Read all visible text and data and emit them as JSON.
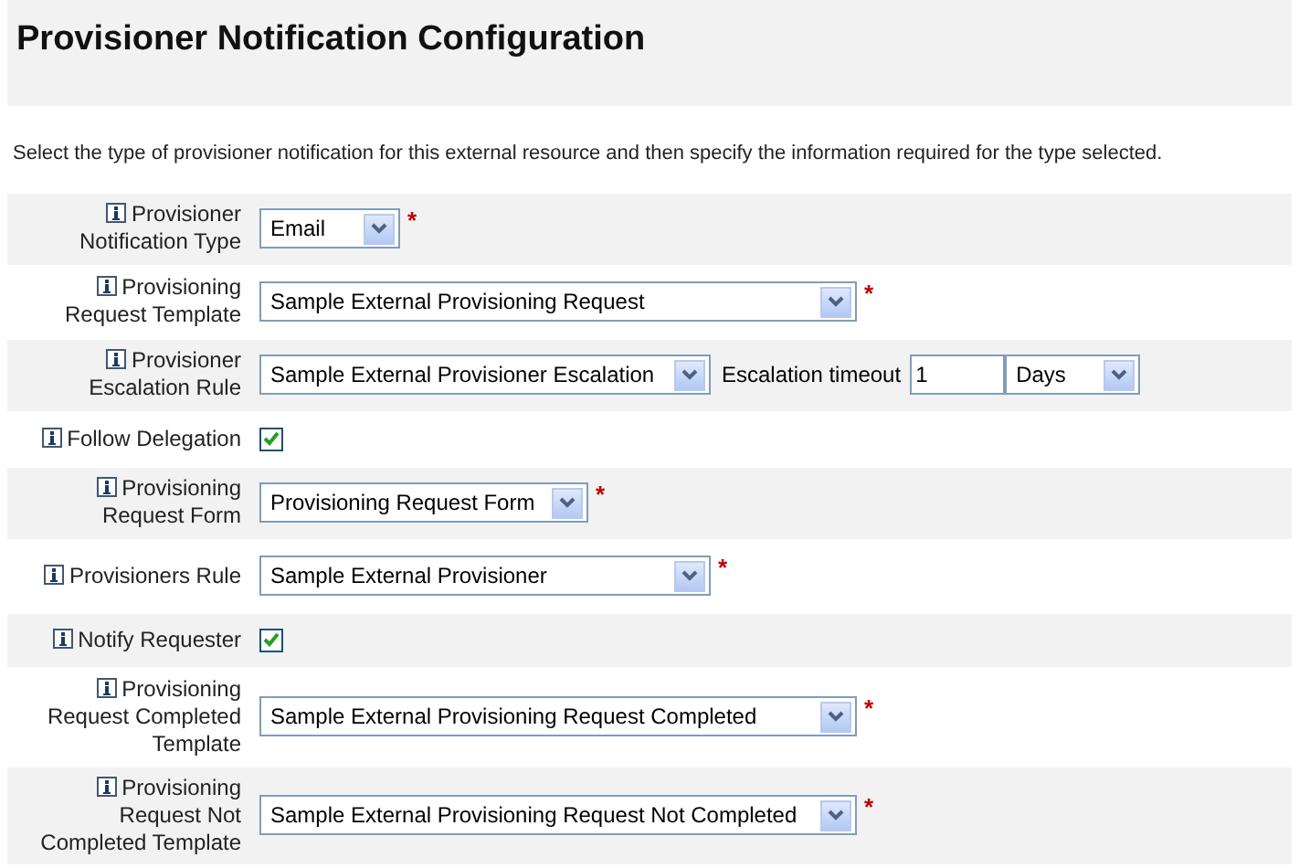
{
  "page": {
    "title": "Provisioner Notification Configuration",
    "description": "Select the type of provisioner notification for this external resource and then specify the information required for the type selected."
  },
  "rows": [
    {
      "kind": "select",
      "label": "Provisioner Notification Type",
      "value": "Email",
      "required_mark": "*"
    },
    {
      "kind": "select",
      "label": "Provisioning Request Template",
      "value": "Sample External Provisioning Request",
      "required_mark": "*"
    },
    {
      "kind": "select",
      "label": "Provisioner Escalation Rule",
      "value": "Sample External Provisioner Escalation",
      "timeout": {
        "label": "Escalation timeout",
        "value": "1",
        "unit": "Days"
      }
    },
    {
      "kind": "checkbox",
      "label": "Follow Delegation",
      "checked": true
    },
    {
      "kind": "select",
      "label": "Provisioning Request Form",
      "value": "Provisioning Request Form",
      "required_mark": "*"
    },
    {
      "kind": "select",
      "label": "Provisioners Rule",
      "value": "Sample External Provisioner",
      "required_mark": "*"
    },
    {
      "kind": "checkbox",
      "label": "Notify Requester",
      "checked": true
    },
    {
      "kind": "select",
      "label": "Provisioning Request Completed Template",
      "value": "Sample External Provisioning Request Completed",
      "required_mark": "*"
    },
    {
      "kind": "select",
      "label": "Provisioning Request Not Completed Template",
      "value": "Sample External Provisioning Request Not Completed",
      "required_mark": "*"
    }
  ]
}
